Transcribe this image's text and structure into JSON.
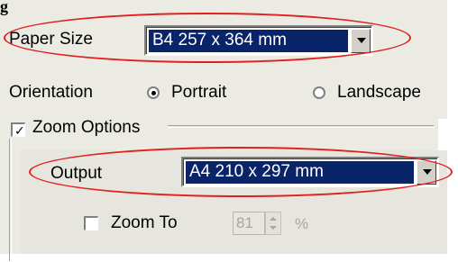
{
  "heading": "g",
  "paper_size": {
    "label": "Paper Size",
    "value": "B4 257 x 364 mm"
  },
  "orientation": {
    "label": "Orientation",
    "options": [
      {
        "label": "Portrait",
        "selected": true
      },
      {
        "label": "Landscape",
        "selected": false
      }
    ]
  },
  "zoom_options": {
    "label": "Zoom Options",
    "checked": true,
    "output": {
      "label": "Output",
      "value": "A4 210 x 297 mm"
    },
    "zoom_to": {
      "label": "Zoom To",
      "checked": false,
      "value": "81",
      "unit": "%"
    }
  },
  "colors": {
    "highlight": "#0a246a",
    "annotation": "#e02020",
    "panel": "#ecebe3"
  }
}
